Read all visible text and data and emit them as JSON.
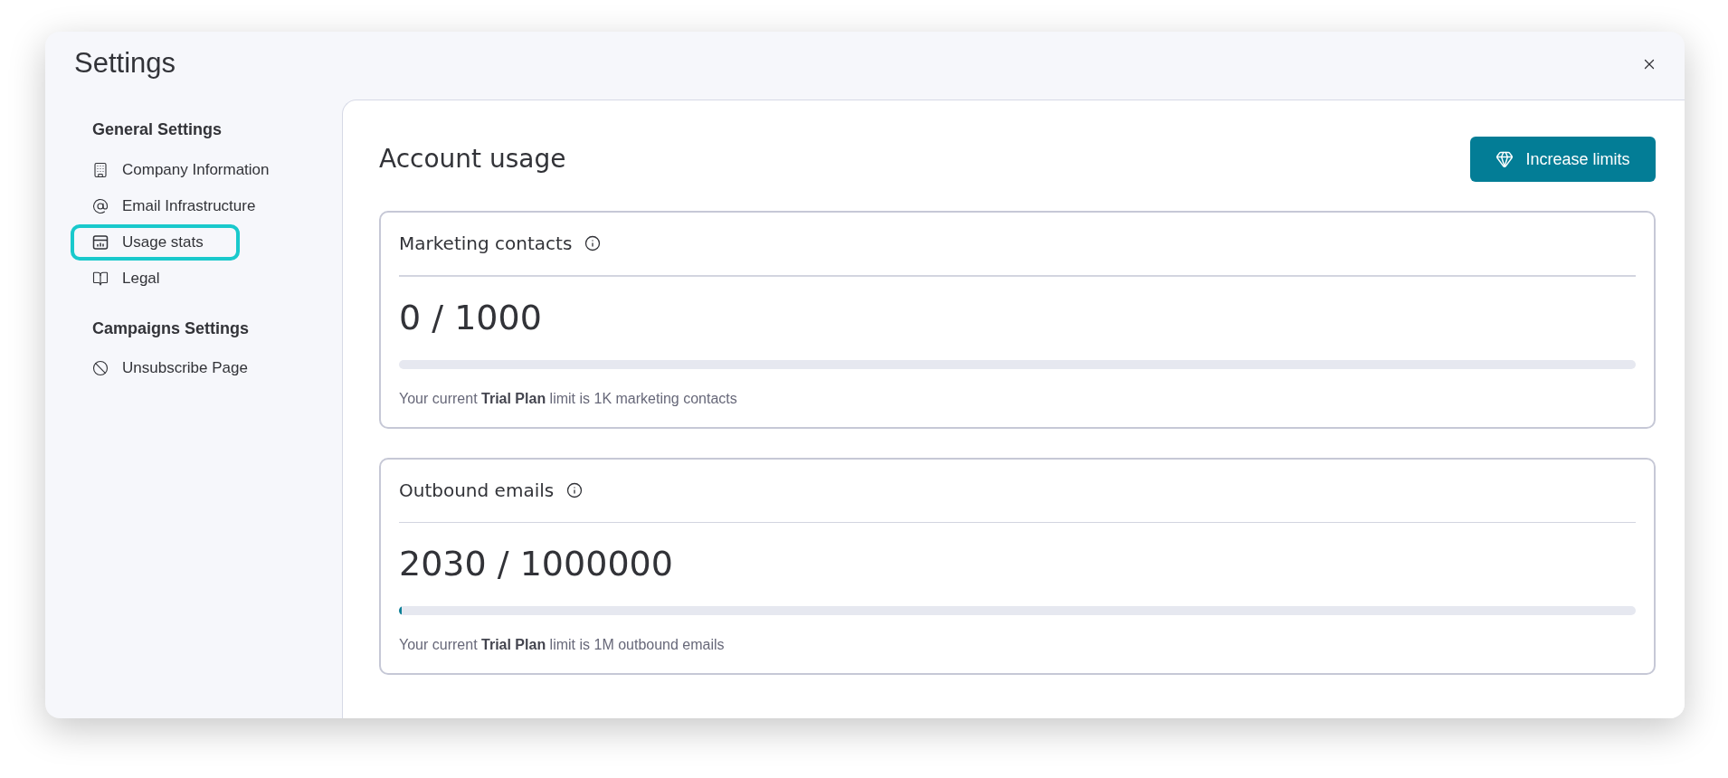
{
  "window": {
    "title": "Settings"
  },
  "sidebar": {
    "sections": [
      {
        "heading": "General Settings",
        "items": [
          {
            "label": "Company Information",
            "selected": false
          },
          {
            "label": "Email Infrastructure",
            "selected": false
          },
          {
            "label": "Usage stats",
            "selected": true
          },
          {
            "label": "Legal",
            "selected": false
          }
        ]
      },
      {
        "heading": "Campaigns Settings",
        "items": [
          {
            "label": "Unsubscribe Page",
            "selected": false
          }
        ]
      }
    ]
  },
  "content": {
    "title": "Account usage",
    "action_button": "Increase limits",
    "cards": [
      {
        "title": "Marketing contacts",
        "usage": "0 / 1000",
        "caption": "Your current **Trial Plan** limit is 1K marketing contacts"
      },
      {
        "title": "Outbound emails",
        "usage": "2030 / 1000000",
        "level": 0.00203,
        "caption": "Your current **Trial Plan** limit is 1M outbound emails"
      }
    ]
  }
}
